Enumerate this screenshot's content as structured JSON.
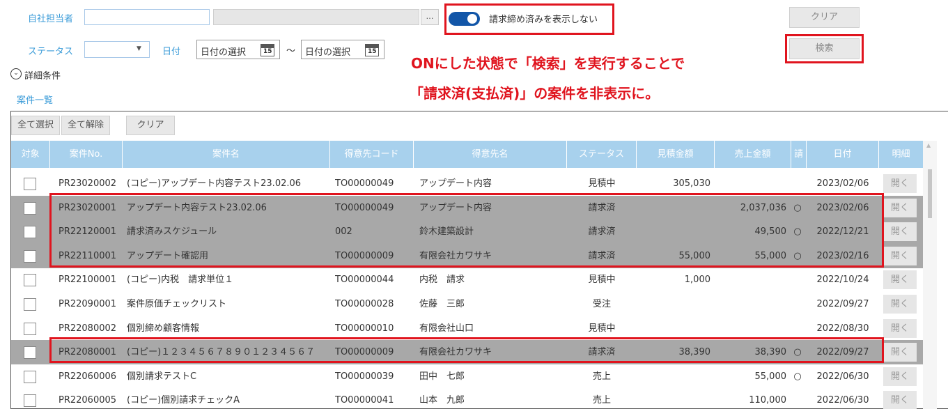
{
  "filters": {
    "assignee_label": "自社担当者",
    "assignee_pick": "…",
    "toggle_label": "請求締め済みを表示しない",
    "clear_label": "クリア",
    "status_label": "ステータス",
    "date_label": "日付",
    "date_from_placeholder": "日付の選択",
    "date_to_placeholder": "日付の選択",
    "calendar_day": "15",
    "tilde": "～",
    "search_label": "検索",
    "detail_label": "詳細条件",
    "detail_icon": "⌄",
    "toggle_on": true
  },
  "annotation": {
    "line1": "ONにした状態で「検索」を実行することで",
    "line2": "「請求済(支払済)」の案件を非表示に。"
  },
  "list": {
    "title": "案件一覧",
    "select_all": "全て選択",
    "unselect_all": "全て解除",
    "clear": "クリア",
    "columns": [
      "対象",
      "案件No.",
      "案件名",
      "得意先コード",
      "得意先名",
      "ステータス",
      "見積金額",
      "売上金額",
      "請",
      "日付",
      "明細"
    ],
    "open_label": "開く",
    "rows": [
      {
        "no": "PR23020002",
        "name": "(コピー)アップデート内容テスト23.02.06",
        "code": "TO00000049",
        "customer": "アップデート内容",
        "status": "見積中",
        "estimate": "305,030",
        "sales": "",
        "billed": "",
        "date": "2023/02/06",
        "grey": false
      },
      {
        "no": "PR23020001",
        "name": "アップデート内容テスト23.02.06",
        "code": "TO00000049",
        "customer": "アップデート内容",
        "status": "請求済",
        "estimate": "",
        "sales": "2,037,036",
        "billed": "○",
        "date": "2023/02/06",
        "grey": true
      },
      {
        "no": "PR22120001",
        "name": "請求済みスケジュール",
        "code": "002",
        "customer": "鈴木建築設計",
        "status": "請求済",
        "estimate": "",
        "sales": "49,500",
        "billed": "○",
        "date": "2022/12/21",
        "grey": true
      },
      {
        "no": "PR22110001",
        "name": "アップデート確認用",
        "code": "TO00000009",
        "customer": "有限会社カワサキ",
        "status": "請求済",
        "estimate": "55,000",
        "sales": "55,000",
        "billed": "○",
        "date": "2023/02/16",
        "grey": true
      },
      {
        "no": "PR22100001",
        "name": "(コピー)内税　請求単位１",
        "code": "TO00000044",
        "customer": "内税　請求",
        "status": "見積中",
        "estimate": "1,000",
        "sales": "",
        "billed": "",
        "date": "2022/10/24",
        "grey": false
      },
      {
        "no": "PR22090001",
        "name": "案件原価チェックリスト",
        "code": "TO00000028",
        "customer": "佐藤　三郎",
        "status": "受注",
        "estimate": "",
        "sales": "",
        "billed": "",
        "date": "2022/09/27",
        "grey": false
      },
      {
        "no": "PR22080002",
        "name": "個別締め顧客情報",
        "code": "TO00000010",
        "customer": "有限会社山口",
        "status": "見積中",
        "estimate": "",
        "sales": "",
        "billed": "",
        "date": "2022/08/30",
        "grey": false
      },
      {
        "no": "PR22080001",
        "name": "(コピー)１２３４５６７８９０１２３４５６７",
        "code": "TO00000009",
        "customer": "有限会社カワサキ",
        "status": "請求済",
        "estimate": "38,390",
        "sales": "38,390",
        "billed": "○",
        "date": "2022/09/27",
        "grey": true
      },
      {
        "no": "PR22060006",
        "name": "個別請求テストC",
        "code": "TO00000039",
        "customer": "田中　七郎",
        "status": "売上",
        "estimate": "",
        "sales": "55,000",
        "billed": "○",
        "date": "2022/06/30",
        "grey": false
      },
      {
        "no": "PR22060005",
        "name": "(コピー)個別請求チェックA",
        "code": "TO00000041",
        "customer": "山本　九郎",
        "status": "売上",
        "estimate": "",
        "sales": "110,000",
        "billed": "",
        "date": "2022/06/30",
        "grey": false
      }
    ]
  },
  "colors": {
    "accent": "#3a9bd8",
    "header_bg": "#a8d1ed",
    "toggle_on": "#1256a8",
    "highlight_red": "#e0141e",
    "grey_row": "#a8a8a8"
  }
}
